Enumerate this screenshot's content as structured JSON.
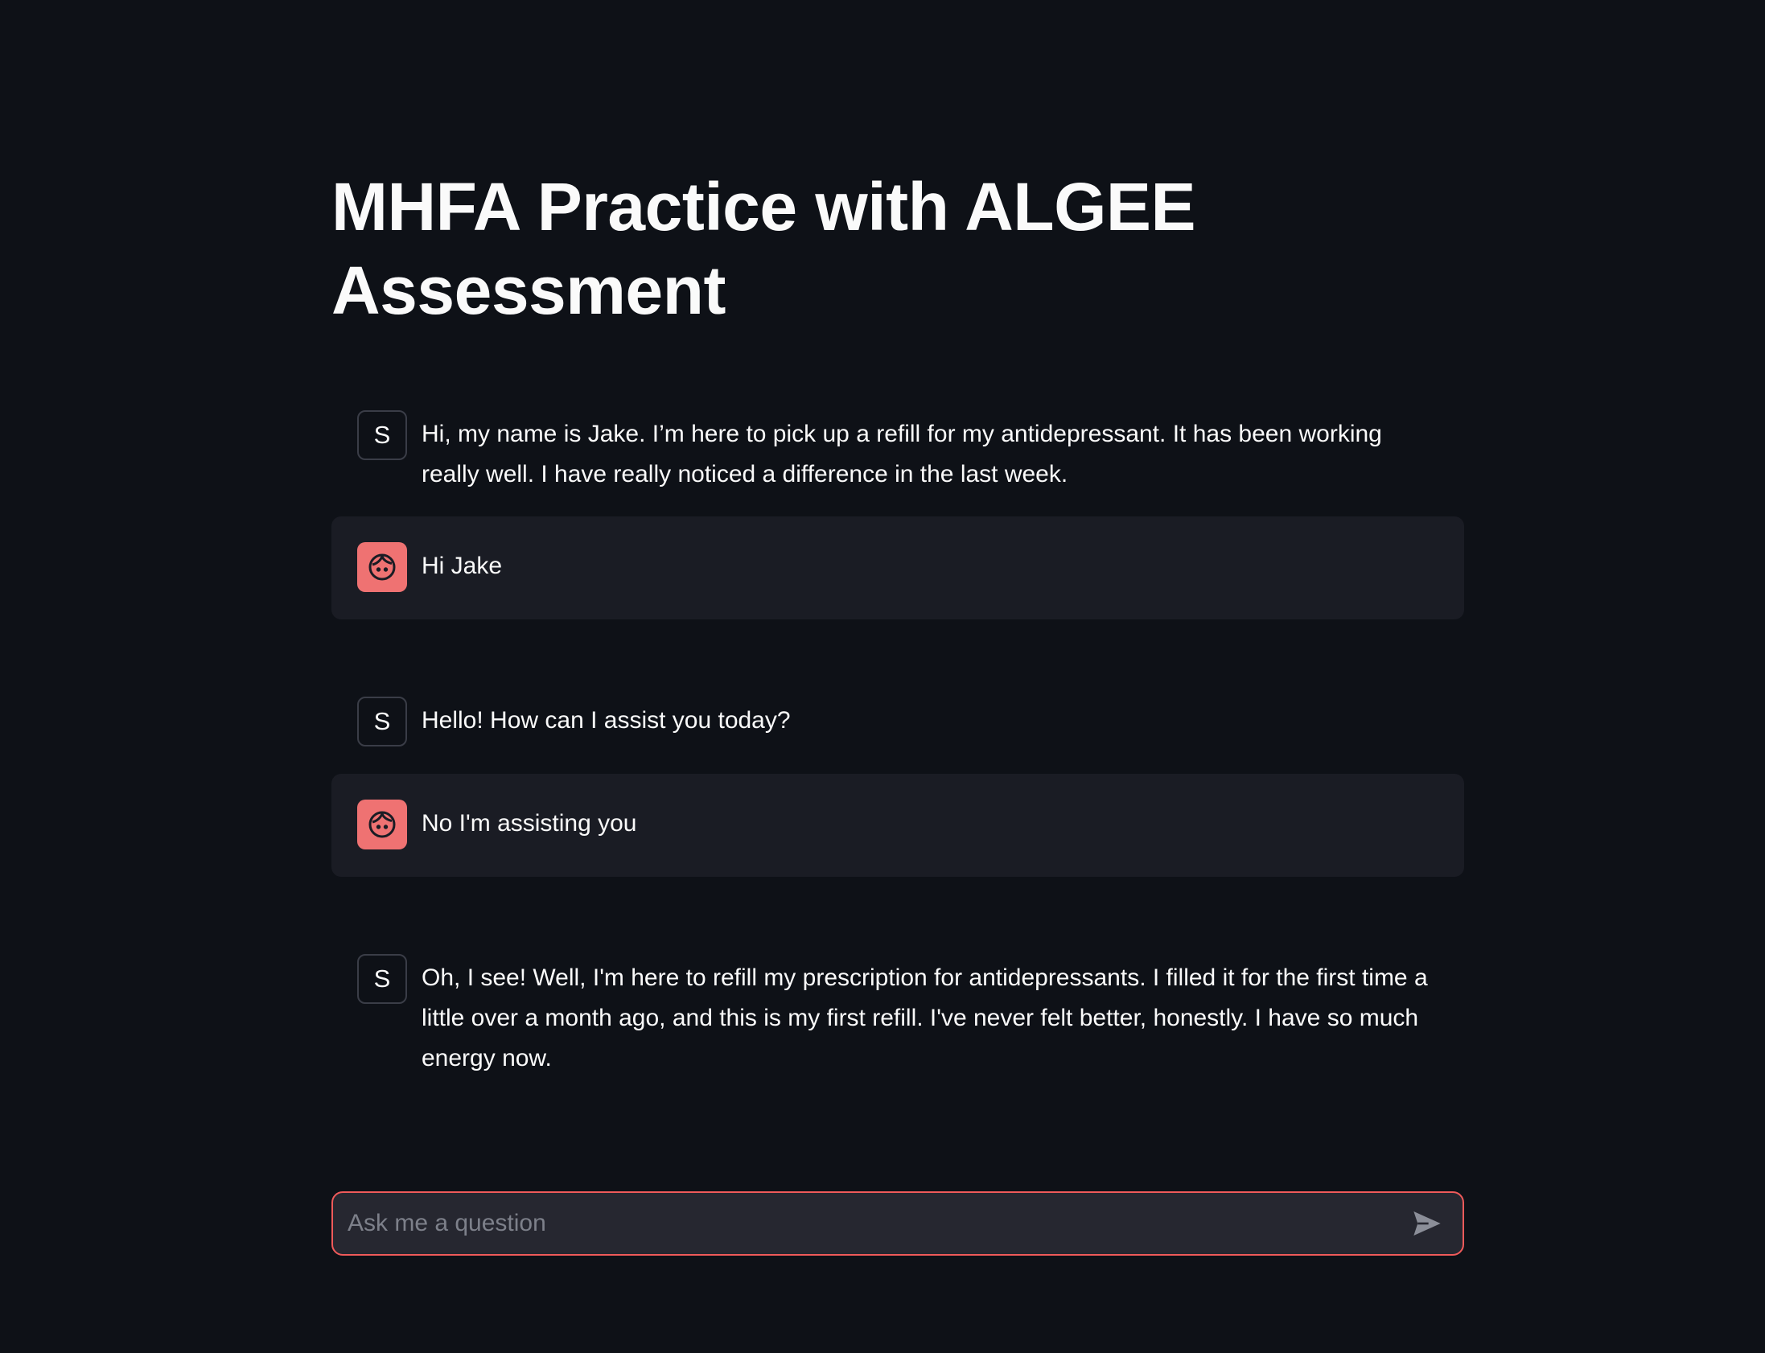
{
  "page": {
    "title": "MHFA Practice with ALGEE Assessment"
  },
  "messages": [
    {
      "role": "assistant",
      "avatar_text": "S",
      "text": "Hi, my name is Jake. I’m here to pick up a refill for my antidepressant. It has been working really well. I have really noticed a difference in the last week."
    },
    {
      "role": "user",
      "avatar_icon": "user-face-icon",
      "text": "Hi Jake"
    },
    {
      "role": "assistant",
      "avatar_text": "S",
      "text": "Hello! How can I assist you today?"
    },
    {
      "role": "user",
      "avatar_icon": "user-face-icon",
      "text": "No I'm assisting you"
    },
    {
      "role": "assistant",
      "avatar_text": "S",
      "text": "Oh, I see! Well, I'm here to refill my prescription for antidepressants. I filled it for the first time a little over a month ago, and this is my first refill. I've never felt better, honestly. I have so much energy now."
    }
  ],
  "chat_input": {
    "placeholder": "Ask me a question",
    "value": "",
    "send_icon": "send-icon"
  },
  "colors": {
    "background": "#0e1117",
    "user_message_bg": "#1a1c24",
    "user_avatar": "#ef7272",
    "input_border": "#ef5a5a",
    "input_bg": "#262730"
  }
}
